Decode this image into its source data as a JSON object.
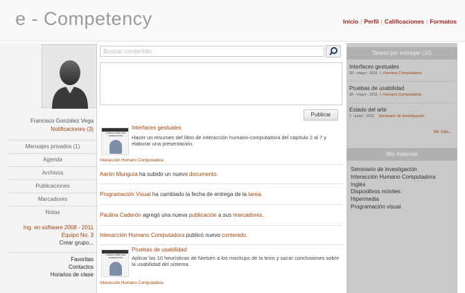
{
  "app": {
    "logo": "e - Competency"
  },
  "topnav": {
    "items": [
      "Inicio",
      "Perfil",
      "Calificaciones",
      "Formatos"
    ]
  },
  "profile": {
    "name": "Francisco González Vega",
    "notifications": "Notificaciones (3)"
  },
  "sidebar": {
    "items": [
      {
        "label": "Mensajes privados (1)"
      },
      {
        "label": "Agenda"
      },
      {
        "label": "Archivos"
      },
      {
        "label": "Publicaciones"
      },
      {
        "label": "Marcadores"
      },
      {
        "label": "Notas"
      }
    ],
    "group": {
      "program": "Ing. en software 2008 - 2011",
      "team": "Equipo No. 3",
      "create": "Crear grupo..."
    },
    "quick": {
      "fav": "Favoritas",
      "contacts": "Contactos",
      "schedule": "Horarios de clase"
    }
  },
  "search": {
    "placeholder": "Buscar contenido"
  },
  "composer": {
    "publish_label": "Publicar"
  },
  "feed": {
    "book_cover_title": "HUMAN-COMPUTER INTERACTION",
    "item1": {
      "title": "Interfaces gestuales",
      "body": "Hacer un resumen  del libro de interacción  humano-computadora  del capítulo 2 al 7 y elaborar una presentación.",
      "course": "Interacción Humano Computadora"
    },
    "item2": {
      "actor": "Aarón Munguía",
      "text": " ha subido un nuevo ",
      "object": "documento",
      "end": "."
    },
    "item3": {
      "actor": "Programación Visual",
      "text": " ha cambiado la fecha de entrega de la ",
      "object": "tarea",
      "end": "."
    },
    "item4": {
      "actor": "Paulina Caderón",
      "text": " agregó una nueva ",
      "object": "publicación",
      "text2": " a sus ",
      "object2": "marcadores",
      "end": "."
    },
    "item5": {
      "actor": "Interacción Humano Computadora",
      "text": " publicó nuevo ",
      "object": "contenido",
      "end": "."
    },
    "item6": {
      "title": "Pruebas de usabilidad",
      "body": "Aplicar las 10 heurísticas de Nielsen a los mockups de la tesis y sacar conclusiones sobre la usabilidad del sistema.",
      "course": "Interacción Humano Computadora"
    }
  },
  "tasks": {
    "heading": "Tareas por entregar (10)",
    "items": [
      {
        "title": "Interfaces gestuales",
        "date": "30 - mayo - 2011",
        "course": "I. Humano Computadora"
      },
      {
        "title": "Pruebas de usabilidad",
        "date": "30 - mayo - 2011",
        "course": "I. Humano Computadora"
      },
      {
        "title": "Estado del arte",
        "date": "1 - junio - 2011",
        "course": "Seminario de Investigación"
      }
    ],
    "more": "Ver más..."
  },
  "subjects": {
    "heading": "Mis materias",
    "items": [
      "Seminario de investigación",
      "Interacción Humano Computadora",
      "Inglés",
      "Dispositivos móviles",
      "Hipermedia",
      "Programación visual"
    ]
  },
  "colors": {
    "accent": "#a0440c",
    "nav": "#9b1b1b",
    "sidebar_bg": "#c9c9c9"
  }
}
